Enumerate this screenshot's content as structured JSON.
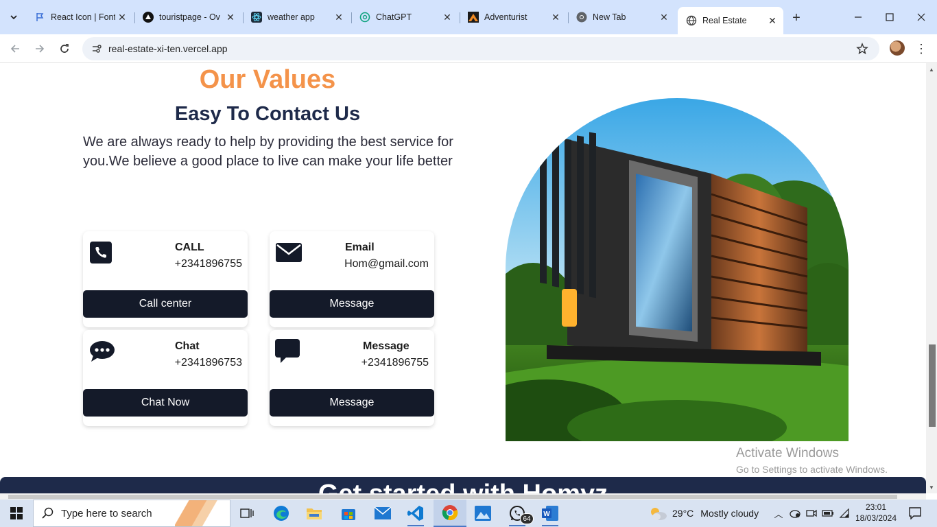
{
  "browser": {
    "tabs": [
      {
        "title": "React Icon | Font",
        "favicon": "flag-icon"
      },
      {
        "title": "touristpage - Ov",
        "favicon": "triangle-logo-icon"
      },
      {
        "title": "weather app",
        "favicon": "react-logo-icon"
      },
      {
        "title": "ChatGPT",
        "favicon": "chatgpt-logo-icon"
      },
      {
        "title": "Adventurist",
        "favicon": "mountain-logo-icon"
      },
      {
        "title": "New Tab",
        "favicon": "chrome-logo-icon"
      },
      {
        "title": "Real Estate",
        "favicon": "globe-icon",
        "active": true
      }
    ],
    "url": "real-estate-xi-ten.vercel.app"
  },
  "page": {
    "values_title": "Our Values",
    "values_subtitle": "Easy To Contact Us",
    "values_description": "We are always ready to help by providing the best service for you.We believe a good place to live can make your life better",
    "cards": [
      {
        "icon": "phone-icon",
        "heading": "CALL",
        "value": "+2341896755",
        "button": "Call center"
      },
      {
        "icon": "envelope-icon",
        "heading": "Email",
        "value": "Hom@gmail.com",
        "button": "Message"
      },
      {
        "icon": "chat-bubble-icon",
        "heading": "Chat",
        "value": "+2341896753",
        "button": "Chat Now"
      },
      {
        "icon": "message-icon",
        "heading": "Message",
        "value": "+2341896755",
        "button": "Message"
      }
    ],
    "cta_text": "Get started with Homyz"
  },
  "watermark": {
    "line1": "Activate Windows",
    "line2": "Go to Settings to activate Windows."
  },
  "taskbar": {
    "search_placeholder": "Type here to search",
    "whatsapp_badge": "64",
    "weather_temp": "29°C",
    "weather_condition": "Mostly cloudy",
    "time": "23:01",
    "date": "18/03/2024"
  },
  "colors": {
    "accent_orange": "#f4934a",
    "navy": "#1e2a4a",
    "button_dark": "#141a29"
  }
}
